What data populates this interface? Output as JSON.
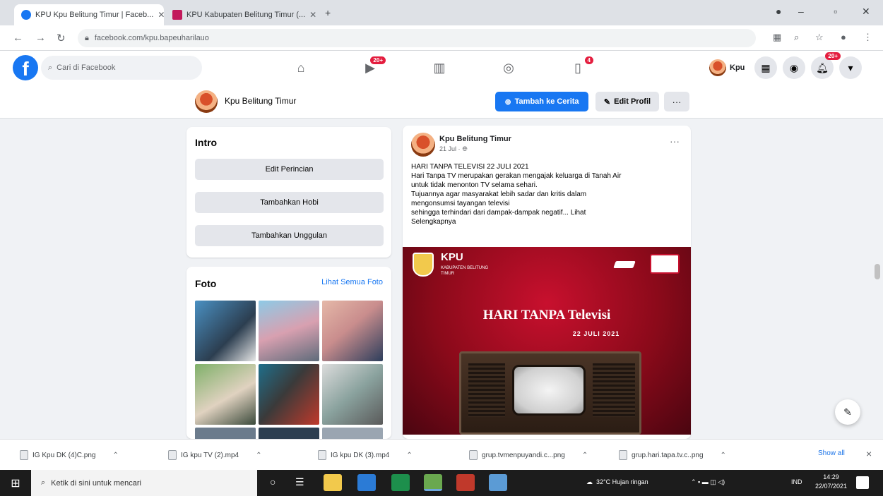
{
  "browser": {
    "tabs": [
      {
        "title": "KPU Kpu Belitung Timur | Faceb..."
      },
      {
        "title": "KPU Kabupaten Belitung Timur (..."
      }
    ],
    "url": "facebook.com/kpu.bapeuharilauo"
  },
  "facebook": {
    "search_placeholder": "Cari di Facebook",
    "notification_badges": {
      "watch": "20+",
      "gaming": "4",
      "notifications": "20+"
    },
    "profile_name": "Kpu"
  },
  "page": {
    "name": "Kpu Belitung Timur",
    "story_button": "Tambah ke Cerita",
    "edit_button": "Edit Profil",
    "more_button": "···"
  },
  "intro": {
    "title": "Intro",
    "buttons": [
      "Edit Perincian",
      "Tambahkan Hobi",
      "Tambahkan Unggulan"
    ]
  },
  "photos": {
    "title": "Foto",
    "see_all": "Lihat Semua Foto"
  },
  "post": {
    "author": "Kpu Belitung Timur",
    "time": "21 Jul · ",
    "menu": "···",
    "lines": [
      "HARI TANPA TELEVISI 22 JULI 2021",
      "Hari Tanpa TV merupakan gerakan mengajak keluarga di Tanah Air",
      "untuk tidak menonton TV selama sehari.",
      "Tujuannya agar masyarakat lebih sadar dan kritis dalam",
      "mengonsumsi tayangan televisi",
      "sehingga terhindari dari dampak-dampak negatif... Lihat",
      "Selengkapnya"
    ],
    "image": {
      "org": "KPU",
      "org_sub": "KABUPATEN BELITUNG TIMUR",
      "headline": "HARI TANPA Televisi",
      "date": "22 JULI 2021"
    }
  },
  "downloads": {
    "items": [
      "IG Kpu DK (4)C.png",
      "IG kpu TV (2).mp4",
      "IG kpu DK (3).mp4",
      "grup.tvmenpuyandi.c...png",
      "grup.hari.tapa.tv.c..png"
    ],
    "show_all": "Show all",
    "close": "×"
  },
  "taskbar": {
    "search_placeholder": "Ketik di sini untuk mencari",
    "weather": "32°C  Hujan ringan",
    "lang": "IND",
    "time": "14:29",
    "date": "22/07/2021"
  }
}
